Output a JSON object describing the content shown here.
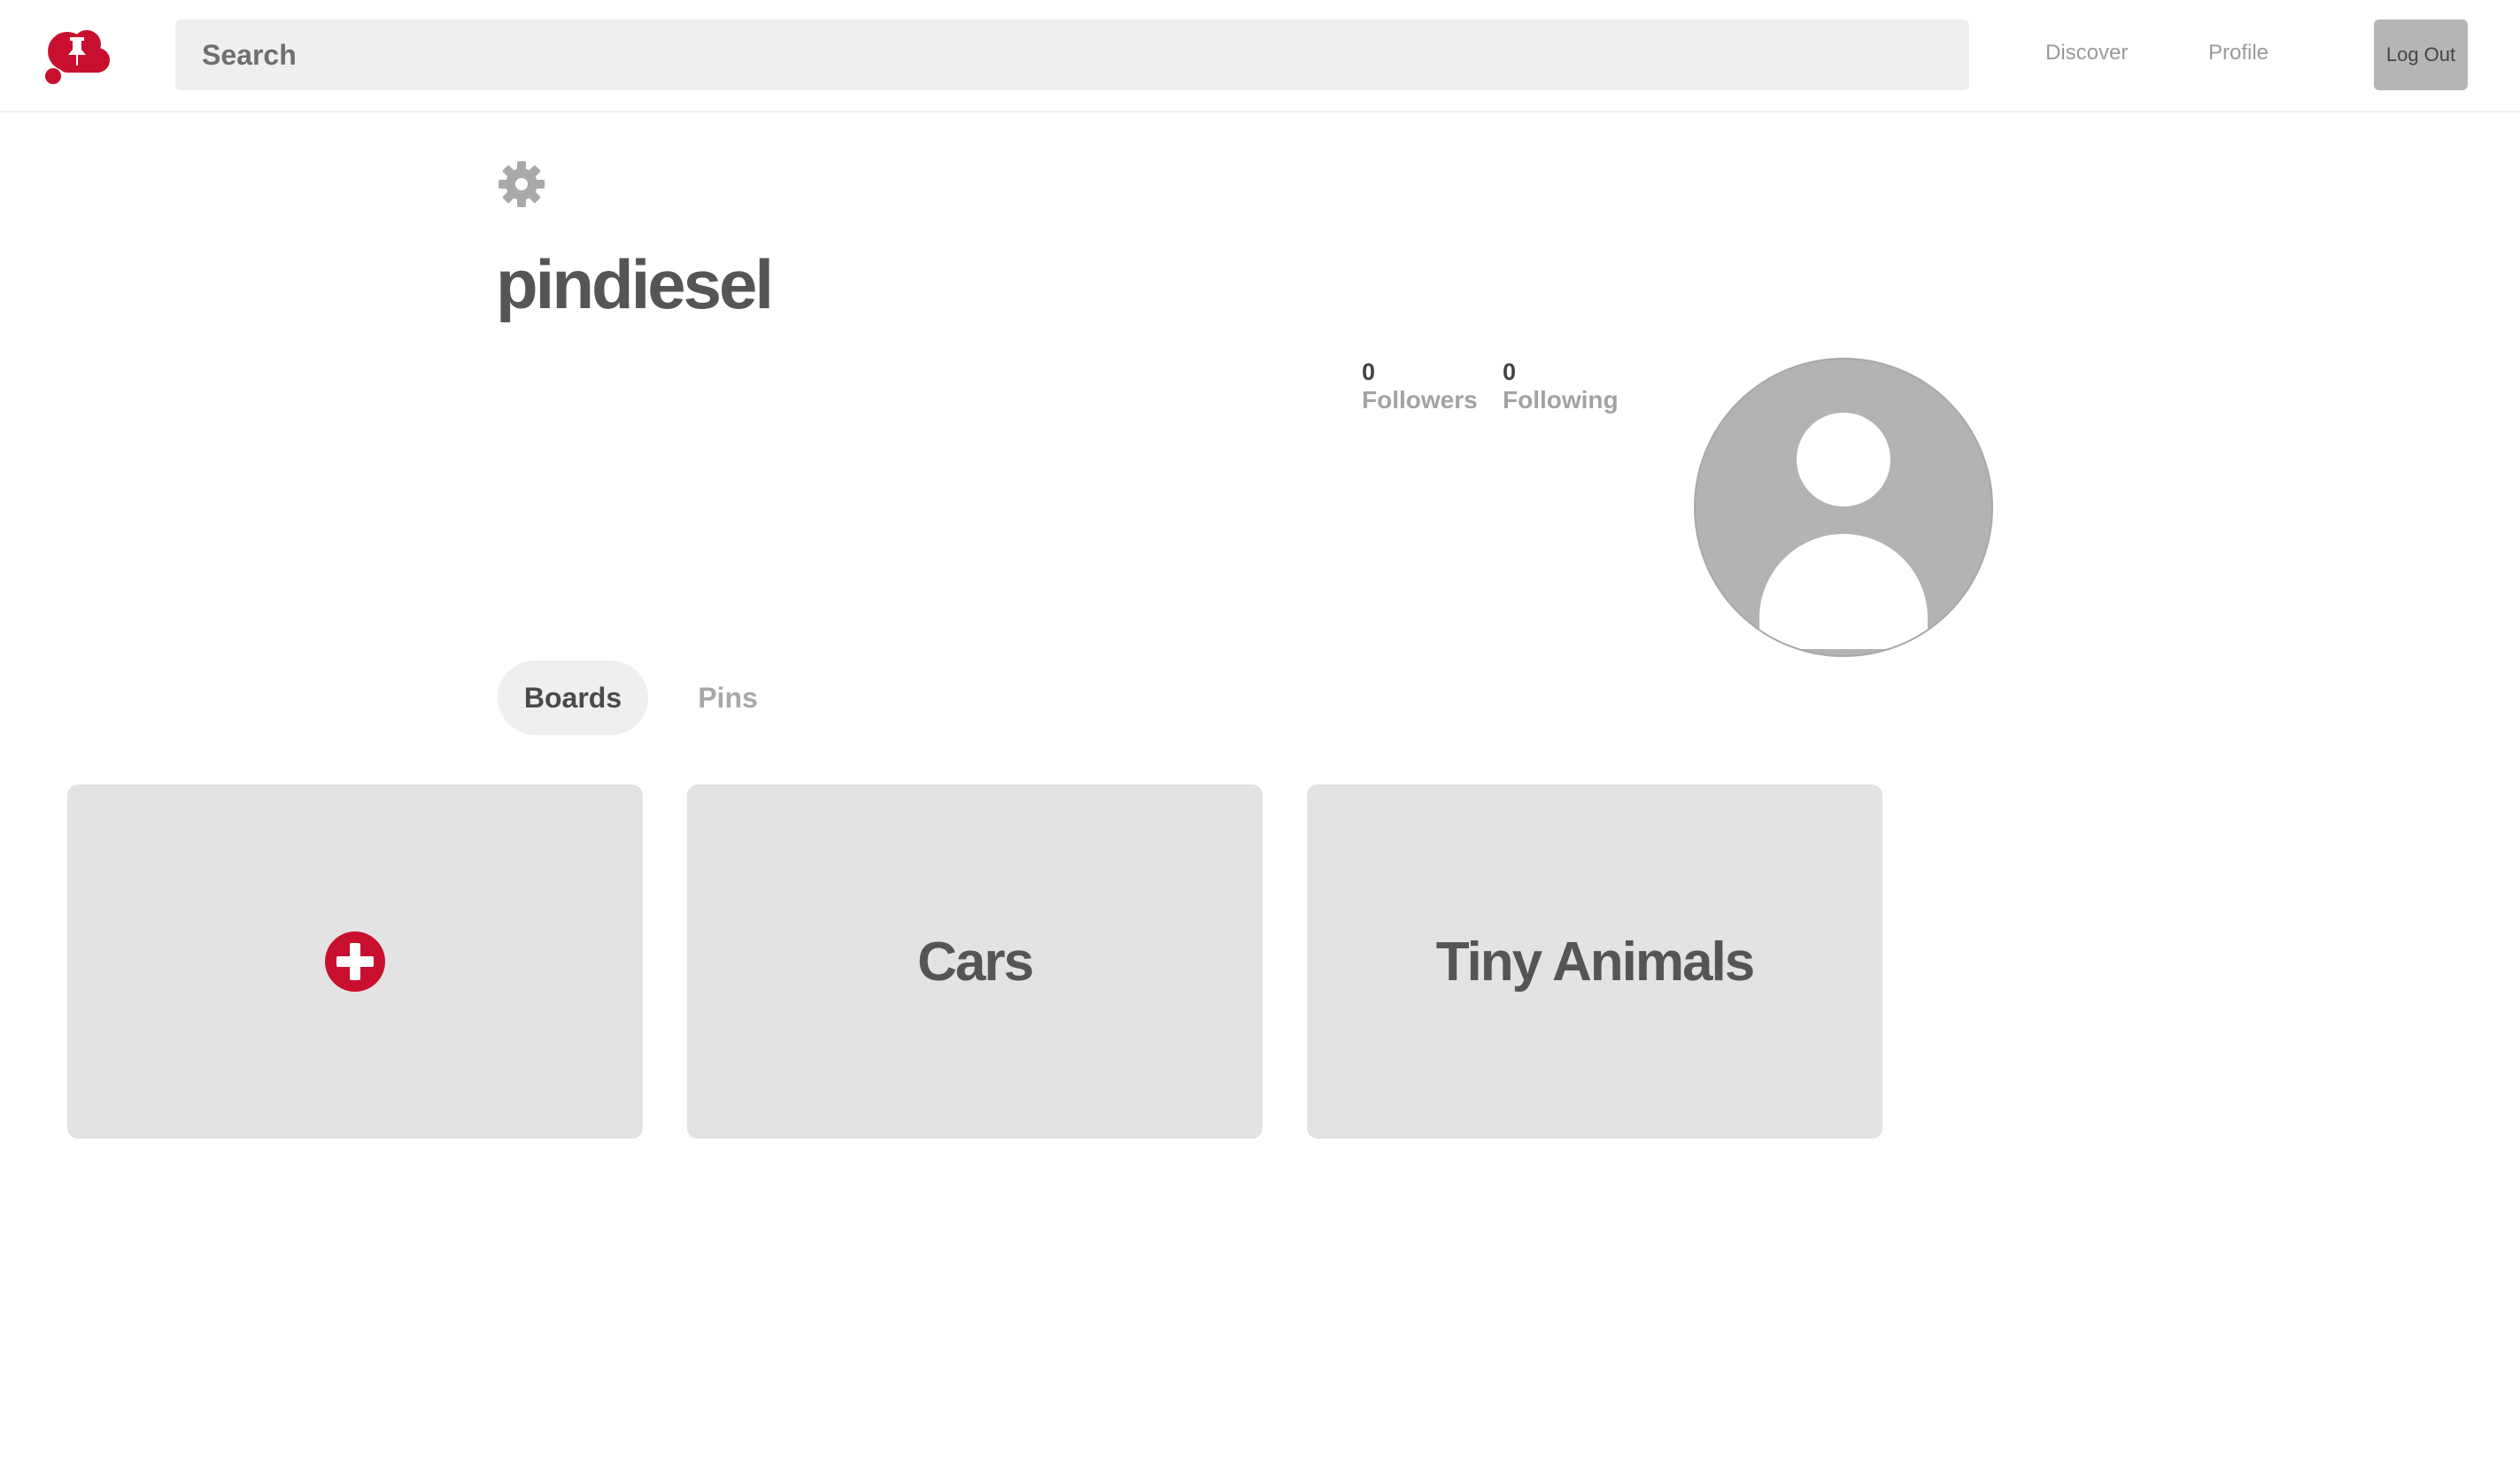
{
  "header": {
    "search_placeholder": "Search",
    "nav": {
      "discover": "Discover",
      "profile": "Profile"
    },
    "logout_label": "Log Out"
  },
  "profile": {
    "username": "pindiesel",
    "followers": {
      "count": "0",
      "label": "Followers"
    },
    "following": {
      "count": "0",
      "label": "Following"
    }
  },
  "tabs": [
    {
      "label": "Boards",
      "active": true
    },
    {
      "label": "Pins",
      "active": false
    }
  ],
  "boards": [
    {
      "type": "create",
      "icon": "add-board-icon"
    },
    {
      "type": "board",
      "title": "Cars"
    },
    {
      "type": "board",
      "title": "Tiny Animals"
    }
  ],
  "colors": {
    "brand": "#c8102e",
    "card_bg": "#e3e3e3",
    "search_bg": "#efefef",
    "logout_bg": "#b5b5b5",
    "avatar_bg": "#b3b3b3"
  },
  "icons": {
    "logo": "pin-cloud-logo",
    "settings": "gear-icon",
    "avatar": "user-avatar-icon",
    "add_board": "plus-circle-icon"
  }
}
